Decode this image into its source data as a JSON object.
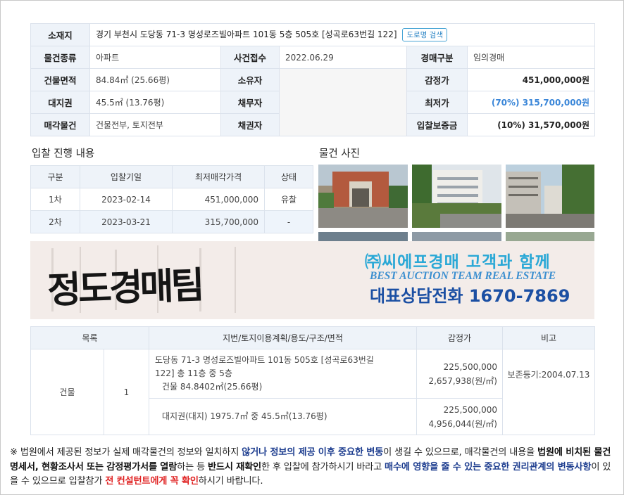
{
  "info": {
    "location_label": "소재지",
    "location_value": "경기 부천시 도당동 71-3 명성로즈빌아파트 101동 5층 505호 [성곡로63번길 122]",
    "road_search_button": "도로명 검색",
    "property_type_label": "물건종류",
    "property_type_value": "아파트",
    "case_received_label": "사건접수",
    "case_received_value": "2022.06.29",
    "auction_type_label": "경매구분",
    "auction_type_value": "임의경매",
    "building_area_label": "건물면적",
    "building_area_value": "84.84㎡ (25.66평)",
    "owner_label": "소유자",
    "appraisal_label": "감정가",
    "appraisal_value": "451,000,000원",
    "land_right_label": "대지권",
    "land_right_value": "45.5㎡ (13.76평)",
    "debtor_label": "채무자",
    "min_price_label": "최저가",
    "min_price_value": "(70%) 315,700,000원",
    "sale_item_label": "매각물건",
    "sale_item_value": "건물전부, 토지전부",
    "creditor_label": "채권자",
    "deposit_label": "입찰보증금",
    "deposit_value": "(10%) 31,570,000원"
  },
  "bid_section": {
    "title": "입찰 진행 내용",
    "headers": [
      "구분",
      "입찰기일",
      "최저매각가격",
      "상태"
    ],
    "rows": [
      {
        "round": "1차",
        "date": "2023-02-14",
        "price": "451,000,000",
        "status": "유찰"
      },
      {
        "round": "2차",
        "date": "2023-03-21",
        "price": "315,700,000",
        "status": "-"
      }
    ]
  },
  "photo_section": {
    "title": "물건 사진"
  },
  "banner": {
    "logo_text": "정도경매팀",
    "line1": "㈜씨에프경매  고객과 함께",
    "line2": "BEST AUCTION TEAM   REAL ESTATE",
    "line3": "대표상담전화 1670-7869"
  },
  "land_table": {
    "headers": [
      "목록",
      "지번/토지이용계획/용도/구조/면적",
      "감정가",
      "비고"
    ],
    "category": "건물",
    "number": "1",
    "row1_addr_line1": "도당동 71-3 명성로즈빌아파트 101동 505호 [성곡로63번길",
    "row1_addr_line2": "122] 총 11층 중 5층",
    "row1_addr_line3": "건물 84.8402㎡(25.66평)",
    "row1_amount": "225,500,000",
    "row1_unit": "2,657,938(원/㎡)",
    "row1_note": "보존등기:2004.07.13",
    "row2_addr": "대지권(대지) 1975.7㎡ 중 45.5㎡(13.76평)",
    "row2_amount": "225,500,000",
    "row2_unit": "4,956,044(원/㎡)"
  },
  "notice": {
    "p1": "※ 법원에서 제공된 정보가 실제 매각물건의 정보와 일치하지 ",
    "p2": "않거나 정보의 제공 이후 중요한 변동",
    "p3": "이 생길 수 있으므로, 매각물건의 내용을 ",
    "p4": "법원에 비치된 물건명세서, 현황조사서 또는 감정평가서를 열람",
    "p5": "하는 등 ",
    "p6": "반드시 재확인",
    "p7": "한 후 입찰에 참가하시기 바라고 ",
    "p8": "매수에 영향을 줄 수 있는 중요한 권리관계의 변동사항",
    "p9": "이 있을 수 있으므로 입찰참가 ",
    "p10": "전 컨설턴트에게 꼭 확인",
    "p11": "하시기 바랍니다."
  },
  "colors": {
    "header_bg": "#eef3f9",
    "border": "#dbe2ec",
    "accent_blue": "#3a86d8",
    "warning_red": "#e02424"
  }
}
